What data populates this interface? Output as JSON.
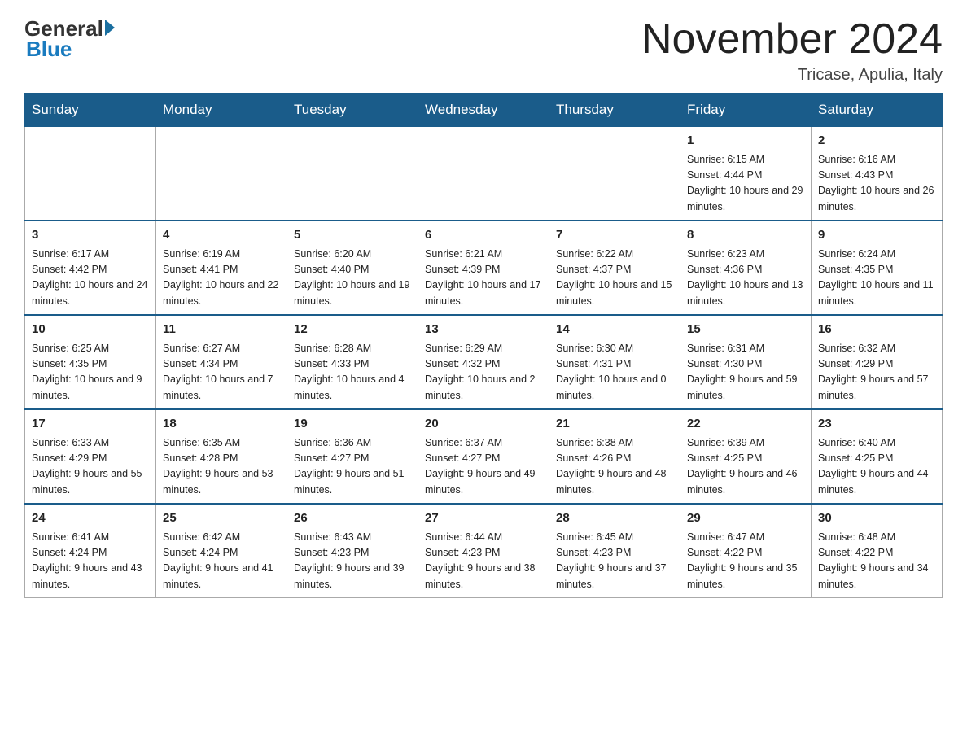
{
  "header": {
    "logo": {
      "general": "General",
      "blue": "Blue"
    },
    "title": "November 2024",
    "subtitle": "Tricase, Apulia, Italy"
  },
  "weekdays": [
    "Sunday",
    "Monday",
    "Tuesday",
    "Wednesday",
    "Thursday",
    "Friday",
    "Saturday"
  ],
  "weeks": [
    [
      {
        "day": "",
        "info": ""
      },
      {
        "day": "",
        "info": ""
      },
      {
        "day": "",
        "info": ""
      },
      {
        "day": "",
        "info": ""
      },
      {
        "day": "",
        "info": ""
      },
      {
        "day": "1",
        "info": "Sunrise: 6:15 AM\nSunset: 4:44 PM\nDaylight: 10 hours and 29 minutes."
      },
      {
        "day": "2",
        "info": "Sunrise: 6:16 AM\nSunset: 4:43 PM\nDaylight: 10 hours and 26 minutes."
      }
    ],
    [
      {
        "day": "3",
        "info": "Sunrise: 6:17 AM\nSunset: 4:42 PM\nDaylight: 10 hours and 24 minutes."
      },
      {
        "day": "4",
        "info": "Sunrise: 6:19 AM\nSunset: 4:41 PM\nDaylight: 10 hours and 22 minutes."
      },
      {
        "day": "5",
        "info": "Sunrise: 6:20 AM\nSunset: 4:40 PM\nDaylight: 10 hours and 19 minutes."
      },
      {
        "day": "6",
        "info": "Sunrise: 6:21 AM\nSunset: 4:39 PM\nDaylight: 10 hours and 17 minutes."
      },
      {
        "day": "7",
        "info": "Sunrise: 6:22 AM\nSunset: 4:37 PM\nDaylight: 10 hours and 15 minutes."
      },
      {
        "day": "8",
        "info": "Sunrise: 6:23 AM\nSunset: 4:36 PM\nDaylight: 10 hours and 13 minutes."
      },
      {
        "day": "9",
        "info": "Sunrise: 6:24 AM\nSunset: 4:35 PM\nDaylight: 10 hours and 11 minutes."
      }
    ],
    [
      {
        "day": "10",
        "info": "Sunrise: 6:25 AM\nSunset: 4:35 PM\nDaylight: 10 hours and 9 minutes."
      },
      {
        "day": "11",
        "info": "Sunrise: 6:27 AM\nSunset: 4:34 PM\nDaylight: 10 hours and 7 minutes."
      },
      {
        "day": "12",
        "info": "Sunrise: 6:28 AM\nSunset: 4:33 PM\nDaylight: 10 hours and 4 minutes."
      },
      {
        "day": "13",
        "info": "Sunrise: 6:29 AM\nSunset: 4:32 PM\nDaylight: 10 hours and 2 minutes."
      },
      {
        "day": "14",
        "info": "Sunrise: 6:30 AM\nSunset: 4:31 PM\nDaylight: 10 hours and 0 minutes."
      },
      {
        "day": "15",
        "info": "Sunrise: 6:31 AM\nSunset: 4:30 PM\nDaylight: 9 hours and 59 minutes."
      },
      {
        "day": "16",
        "info": "Sunrise: 6:32 AM\nSunset: 4:29 PM\nDaylight: 9 hours and 57 minutes."
      }
    ],
    [
      {
        "day": "17",
        "info": "Sunrise: 6:33 AM\nSunset: 4:29 PM\nDaylight: 9 hours and 55 minutes."
      },
      {
        "day": "18",
        "info": "Sunrise: 6:35 AM\nSunset: 4:28 PM\nDaylight: 9 hours and 53 minutes."
      },
      {
        "day": "19",
        "info": "Sunrise: 6:36 AM\nSunset: 4:27 PM\nDaylight: 9 hours and 51 minutes."
      },
      {
        "day": "20",
        "info": "Sunrise: 6:37 AM\nSunset: 4:27 PM\nDaylight: 9 hours and 49 minutes."
      },
      {
        "day": "21",
        "info": "Sunrise: 6:38 AM\nSunset: 4:26 PM\nDaylight: 9 hours and 48 minutes."
      },
      {
        "day": "22",
        "info": "Sunrise: 6:39 AM\nSunset: 4:25 PM\nDaylight: 9 hours and 46 minutes."
      },
      {
        "day": "23",
        "info": "Sunrise: 6:40 AM\nSunset: 4:25 PM\nDaylight: 9 hours and 44 minutes."
      }
    ],
    [
      {
        "day": "24",
        "info": "Sunrise: 6:41 AM\nSunset: 4:24 PM\nDaylight: 9 hours and 43 minutes."
      },
      {
        "day": "25",
        "info": "Sunrise: 6:42 AM\nSunset: 4:24 PM\nDaylight: 9 hours and 41 minutes."
      },
      {
        "day": "26",
        "info": "Sunrise: 6:43 AM\nSunset: 4:23 PM\nDaylight: 9 hours and 39 minutes."
      },
      {
        "day": "27",
        "info": "Sunrise: 6:44 AM\nSunset: 4:23 PM\nDaylight: 9 hours and 38 minutes."
      },
      {
        "day": "28",
        "info": "Sunrise: 6:45 AM\nSunset: 4:23 PM\nDaylight: 9 hours and 37 minutes."
      },
      {
        "day": "29",
        "info": "Sunrise: 6:47 AM\nSunset: 4:22 PM\nDaylight: 9 hours and 35 minutes."
      },
      {
        "day": "30",
        "info": "Sunrise: 6:48 AM\nSunset: 4:22 PM\nDaylight: 9 hours and 34 minutes."
      }
    ]
  ]
}
